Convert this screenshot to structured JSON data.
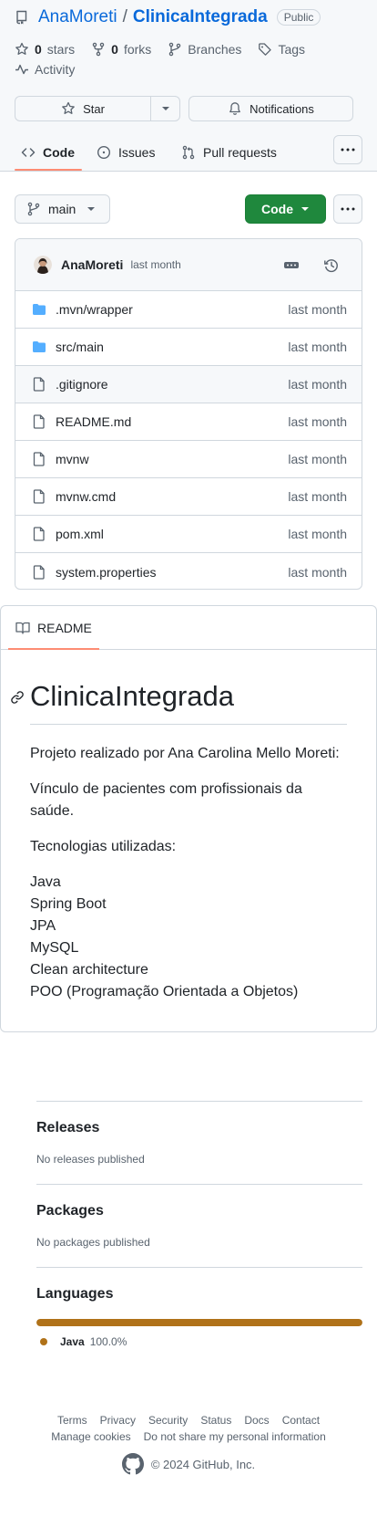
{
  "repo": {
    "owner": "AnaMoreti",
    "separator": "/",
    "name": "ClinicaIntegrada",
    "visibility": "Public"
  },
  "stats": {
    "stars_count": "0",
    "stars_label": "stars",
    "forks_count": "0",
    "forks_label": "forks",
    "branches": "Branches",
    "tags": "Tags",
    "activity": "Activity"
  },
  "actions": {
    "star": "Star",
    "notifications": "Notifications"
  },
  "tabs": [
    {
      "label": "Code"
    },
    {
      "label": "Issues"
    },
    {
      "label": "Pull requests"
    }
  ],
  "toolbar": {
    "branch": "main",
    "code_button": "Code"
  },
  "commit": {
    "author": "AnaMoreti",
    "time": "last month"
  },
  "files": [
    {
      "name": ".mvn/wrapper",
      "type": "folder",
      "date": "last month"
    },
    {
      "name": "src/main",
      "type": "folder",
      "date": "last month"
    },
    {
      "name": ".gitignore",
      "type": "file",
      "date": "last month"
    },
    {
      "name": "README.md",
      "type": "file",
      "date": "last month"
    },
    {
      "name": "mvnw",
      "type": "file",
      "date": "last month"
    },
    {
      "name": "mvnw.cmd",
      "type": "file",
      "date": "last month"
    },
    {
      "name": "pom.xml",
      "type": "file",
      "date": "last month"
    },
    {
      "name": "system.properties",
      "type": "file",
      "date": "last month"
    }
  ],
  "readme": {
    "tab_label": "README",
    "heading": "ClinicaIntegrada",
    "p1": "Projeto realizado por Ana Carolina Mello Moreti:",
    "p2": "Vínculo de pacientes com profissionais da saúde.",
    "p3": "Tecnologias utilizadas:",
    "tech": [
      "Java",
      "Spring Boot",
      "JPA",
      "MySQL",
      "Clean architecture",
      "POO (Programação Orientada a Objetos)"
    ]
  },
  "sidebar": {
    "releases_title": "Releases",
    "releases_empty": "No releases published",
    "packages_title": "Packages",
    "packages_empty": "No packages published",
    "languages_title": "Languages",
    "languages": [
      {
        "name": "Java",
        "percent": "100.0%",
        "fraction": 1.0,
        "color": "#b07219"
      }
    ]
  },
  "footer": {
    "links_row1": [
      "Terms",
      "Privacy",
      "Security",
      "Status",
      "Docs",
      "Contact"
    ],
    "links_row2": [
      "Manage cookies",
      "Do not share my personal information"
    ],
    "copyright": "© 2024 GitHub, Inc."
  },
  "colors": {
    "accent": "#0969da",
    "primary_button": "#1f883d",
    "tab_underline": "#fd8c73",
    "folder": "#54aeff"
  }
}
